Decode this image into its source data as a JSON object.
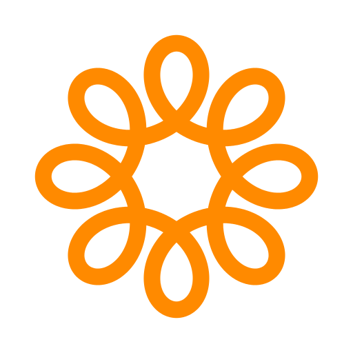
{
  "logo": {
    "icon": "looped-flower-logo-icon",
    "color": "#FF8A00",
    "background": "#FFFFFF",
    "petal_count": 8
  }
}
